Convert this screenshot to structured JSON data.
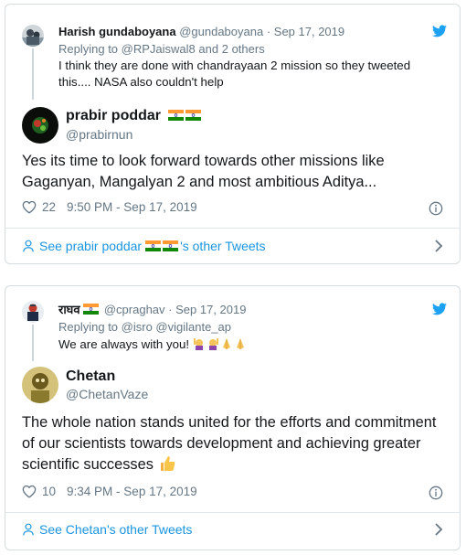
{
  "tweets": [
    {
      "parent": {
        "name": "Harish gundaboyana",
        "handle": "@gundaboyana",
        "date": "· Sep 17, 2019",
        "replying_prefix": "Replying to",
        "replying_users": "@RPJaiswal8",
        "replying_suffix": "and 2 others",
        "text": "I think they are done with chandrayaan 2 mission so they tweeted this.... NASA also couldn't help"
      },
      "main": {
        "name": "prabir poddar",
        "handle": "@prabirnun",
        "text": "Yes its time to look forward towards other missions like Gaganyan, Mangalyan 2 and most ambitious Aditya...",
        "likes": "22",
        "time": "9:50 PM - Sep 17, 2019"
      },
      "footer": {
        "prefix": "See prabir poddar",
        "suffix": "'s other Tweets"
      }
    },
    {
      "parent": {
        "name": "राघव",
        "handle": "@cpraghav",
        "date": "· Sep 17, 2019",
        "replying_prefix": "Replying to",
        "replying_users": "@isro @vigilante_ap",
        "text": "We are always with you!"
      },
      "main": {
        "name": "Chetan",
        "handle": "@ChetanVaze",
        "text": "The whole nation stands united for the efforts and commitment of our scientists towards development and achieving greater scientific successes",
        "likes": "10",
        "time": "9:34 PM - Sep 17, 2019"
      },
      "footer": {
        "label": "See Chetan's other Tweets"
      }
    }
  ],
  "icons": {
    "bird": "twitter-bird-icon",
    "heart": "heart-icon",
    "info": "info-icon",
    "person": "person-icon",
    "chevron": "chevron-right-icon",
    "flag": "indian-flag-icon"
  },
  "colors": {
    "link": "#1b95e0",
    "muted": "#657786",
    "text": "#14171a",
    "border": "#d6dce1",
    "twitter_blue": "#1da1f2"
  }
}
